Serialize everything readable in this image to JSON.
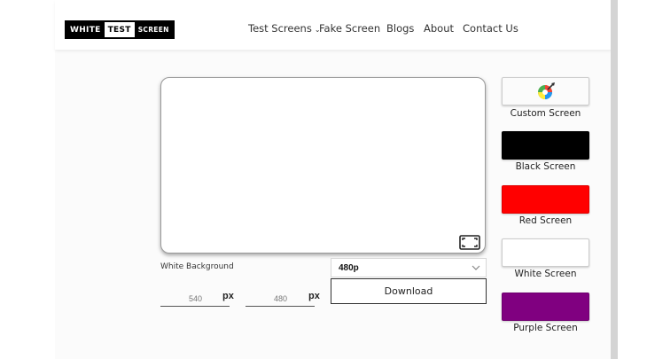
{
  "brand": {
    "word1": "WHITE",
    "word2": "TEST",
    "word3": "SCREEN"
  },
  "nav": {
    "items": [
      {
        "label": "Test Screens",
        "has_dropdown": true,
        "chevron": "⌄"
      },
      {
        "label": "Fake Screen"
      },
      {
        "label": "Blogs"
      },
      {
        "label": "About"
      },
      {
        "label": "Contact Us"
      }
    ]
  },
  "preview": {
    "color": "#ffffff",
    "fullscreen_icon": "fullscreen-icon"
  },
  "controls": {
    "background_label": "White Background",
    "width": {
      "value": "540",
      "unit": "px"
    },
    "height": {
      "value": "480",
      "unit": "px"
    },
    "resolution": {
      "selected": "480p"
    },
    "download_label": "Download"
  },
  "swatches": [
    {
      "label": "Custom Screen",
      "color": "#ffffff",
      "icon": "color-wheel-icon"
    },
    {
      "label": "Black Screen",
      "color": "#000000"
    },
    {
      "label": "Red Screen",
      "color": "#ff0000"
    },
    {
      "label": "White Screen",
      "color": "#ffffff"
    },
    {
      "label": "Purple Screen",
      "color": "#800080"
    }
  ]
}
